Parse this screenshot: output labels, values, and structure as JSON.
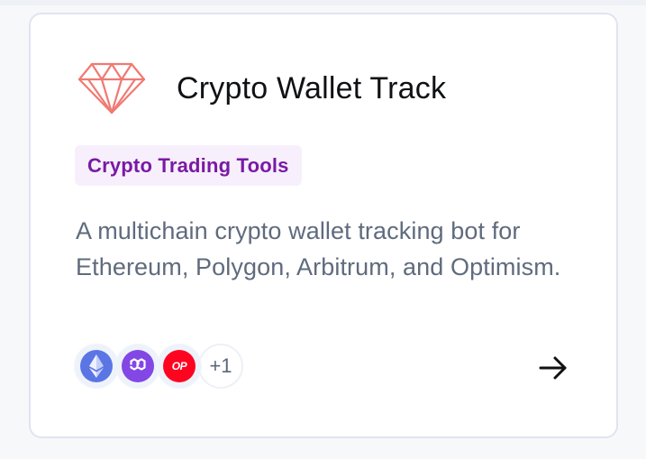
{
  "card": {
    "title": "Crypto Wallet Track",
    "category": "Crypto Trading Tools",
    "description": "A multichain crypto wallet tracking bot for Ethereum, Polygon, Arbitrum, and Optimism.",
    "logo_icon": "diamond-icon",
    "networks": [
      {
        "icon": "ethereum-icon",
        "color": "#5b75e5"
      },
      {
        "icon": "polygon-icon",
        "color": "#8247e5"
      },
      {
        "icon": "optimism-icon",
        "label": "OP",
        "color": "#ff0420"
      }
    ],
    "more_networks": "+1",
    "action_icon": "arrow-right-icon"
  },
  "colors": {
    "tag_text": "#7a1aa4",
    "tag_background": "#f7f0fc",
    "logo_stroke": "#ef7a72",
    "card_border": "#dfe4f1",
    "description_text": "#5f6b7d"
  }
}
